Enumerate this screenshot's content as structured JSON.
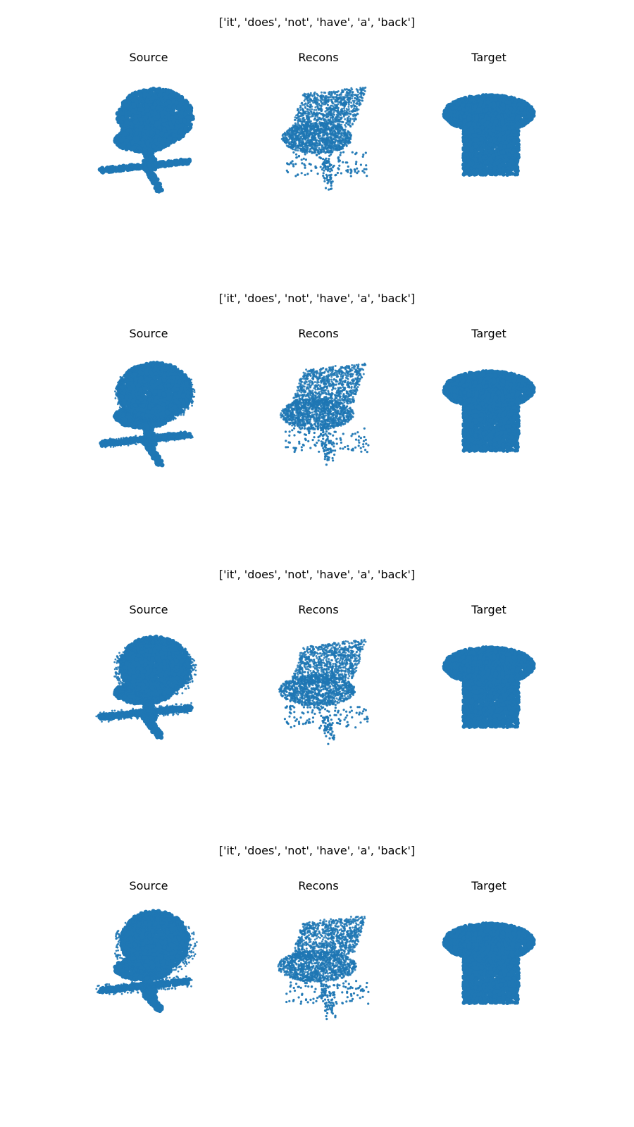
{
  "figure": {
    "rows": [
      {
        "title": "['it', 'does', 'not', 'have', 'a', 'back']",
        "panels": [
          {
            "title": "Source",
            "shape": "swivel-chair-round-back"
          },
          {
            "title": "Recons",
            "shape": "seat-with-sloped-back"
          },
          {
            "title": "Target",
            "shape": "backless-stool-rounded-top"
          }
        ]
      },
      {
        "title": "['it', 'does', 'not', 'have', 'a', 'back']",
        "panels": [
          {
            "title": "Source",
            "shape": "swivel-chair-round-back"
          },
          {
            "title": "Recons",
            "shape": "seat-with-sloped-back"
          },
          {
            "title": "Target",
            "shape": "backless-stool-rounded-top"
          }
        ]
      },
      {
        "title": "['it', 'does', 'not', 'have', 'a', 'back']",
        "panels": [
          {
            "title": "Source",
            "shape": "swivel-chair-round-back"
          },
          {
            "title": "Recons",
            "shape": "seat-with-sloped-back"
          },
          {
            "title": "Target",
            "shape": "backless-stool-rounded-top"
          }
        ]
      },
      {
        "title": "['it', 'does', 'not', 'have', 'a', 'back']",
        "panels": [
          {
            "title": "Source",
            "shape": "swivel-chair-round-back"
          },
          {
            "title": "Recons",
            "shape": "seat-with-sloped-back"
          },
          {
            "title": "Target",
            "shape": "backless-stool-rounded-top"
          }
        ]
      }
    ]
  },
  "chart_data": {
    "type": "scatter",
    "plot_kind": "3d point clouds",
    "point_color": "#1f77b4",
    "axes_visible": false,
    "grid": false,
    "legend": "none",
    "grid_layout": {
      "rows": 4,
      "columns": 3
    },
    "column_titles": [
      "Source",
      "Recons",
      "Target"
    ]
  }
}
